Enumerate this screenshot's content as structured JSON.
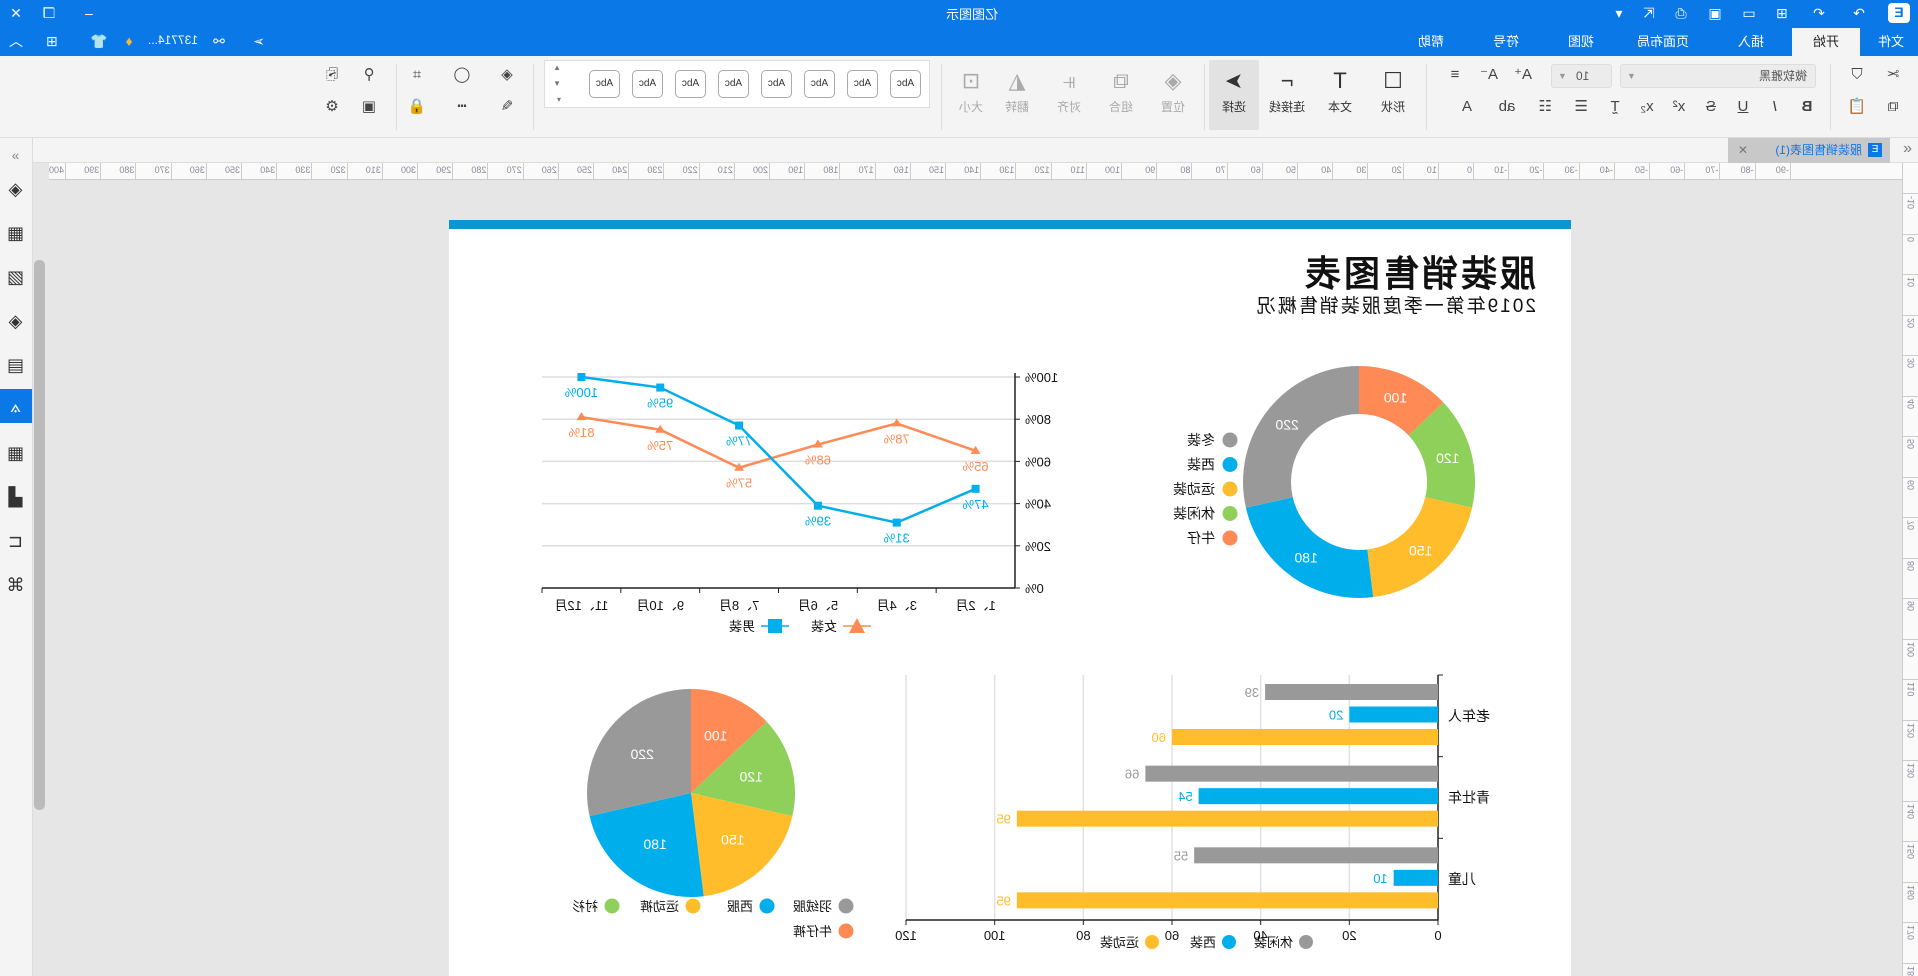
{
  "titlebar": {
    "app_title": "亿图图示",
    "user": "137714...",
    "logo": "E"
  },
  "tabs": [
    {
      "label": "文件"
    },
    {
      "label": "开始",
      "active": true
    },
    {
      "label": "插入"
    },
    {
      "label": "页面布局"
    },
    {
      "label": "视图"
    },
    {
      "label": "符号"
    },
    {
      "label": "帮助"
    }
  ],
  "ribbon": {
    "font_name": "微软雅黑",
    "font_size": "10",
    "tools": [
      {
        "label": "形状",
        "icon": "square-icon"
      },
      {
        "label": "文本",
        "icon": "text-icon"
      },
      {
        "label": "连接线",
        "icon": "connector-icon"
      },
      {
        "label": "选择",
        "icon": "select-arrow-icon",
        "active": true
      }
    ],
    "arrange": [
      {
        "label": "位置"
      },
      {
        "label": "组合"
      },
      {
        "label": "对齐"
      },
      {
        "label": "翻转"
      },
      {
        "label": "大小"
      }
    ],
    "styles": [
      "Abc",
      "Abc",
      "Abc",
      "Abc",
      "Abc",
      "Abc",
      "Abc",
      "Abc"
    ]
  },
  "document_tab": {
    "label": "服装销售图表(1)"
  },
  "ruler": {
    "h_start": -90,
    "h_end": 400,
    "h_step": 10,
    "v_start": -10,
    "v_end": 190,
    "v_step": 10
  },
  "page": {
    "title": "服装销售图表",
    "subtitle": "2019年第一季度服装销售概况",
    "accent": "#0a96d0"
  },
  "chart_data": [
    {
      "type": "line",
      "categories": [
        "1、2月",
        "3、4月",
        "5、6月",
        "7、8月",
        "9、10月",
        "11、12月"
      ],
      "ylim": [
        0,
        100
      ],
      "yticks": [
        "0%",
        "20%",
        "40%",
        "60%",
        "80%",
        "100%"
      ],
      "grid": true,
      "legend": "bottom",
      "series": [
        {
          "name": "女装",
          "values": [
            65,
            78,
            68,
            57,
            75,
            81
          ],
          "color": "#ff8a55",
          "marker": "triangle"
        },
        {
          "name": "男装",
          "values": [
            47,
            31,
            39,
            77,
            95,
            100
          ],
          "color": "#00aeeb",
          "marker": "square"
        }
      ]
    },
    {
      "type": "pie",
      "donut": true,
      "legend": "right",
      "slices": [
        {
          "name": "牛仔",
          "value": 100,
          "color": "#ff8a55"
        },
        {
          "name": "休闲装",
          "value": 120,
          "color": "#8ed05a"
        },
        {
          "name": "运动装",
          "value": 150,
          "color": "#ffbd2c"
        },
        {
          "name": "西装",
          "value": 180,
          "color": "#00aeeb"
        },
        {
          "name": "冬装",
          "value": 220,
          "color": "#999999"
        }
      ],
      "legend_order": [
        "冬装",
        "西装",
        "运动装",
        "休闲装",
        "牛仔"
      ]
    },
    {
      "type": "bar",
      "orientation": "horizontal",
      "categories": [
        "老年人",
        "青壮年",
        "儿童"
      ],
      "xlim": [
        0,
        120
      ],
      "xticks": [
        0,
        20,
        40,
        60,
        80,
        100,
        120
      ],
      "legend": "bottom",
      "series": [
        {
          "name": "休闲装",
          "values": [
            39,
            66,
            55
          ],
          "color": "#999999"
        },
        {
          "name": "西装",
          "values": [
            20,
            54,
            10
          ],
          "color": "#00aeeb"
        },
        {
          "name": "运动装",
          "values": [
            60,
            95,
            95
          ],
          "color": "#ffbd2c"
        }
      ]
    },
    {
      "type": "pie",
      "legend": "bottom",
      "slices": [
        {
          "name": "牛仔裤",
          "value": 100,
          "color": "#ff8a55"
        },
        {
          "name": "衬衫",
          "value": 120,
          "color": "#8ed05a"
        },
        {
          "name": "运动裤",
          "value": 150,
          "color": "#ffbd2c"
        },
        {
          "name": "西服",
          "value": 180,
          "color": "#00aeeb"
        },
        {
          "name": "羽绒服",
          "value": 220,
          "color": "#999999"
        }
      ],
      "legend_order": [
        "羽绒服",
        "西服",
        "运动裤",
        "衬衫",
        "牛仔裤"
      ]
    }
  ]
}
